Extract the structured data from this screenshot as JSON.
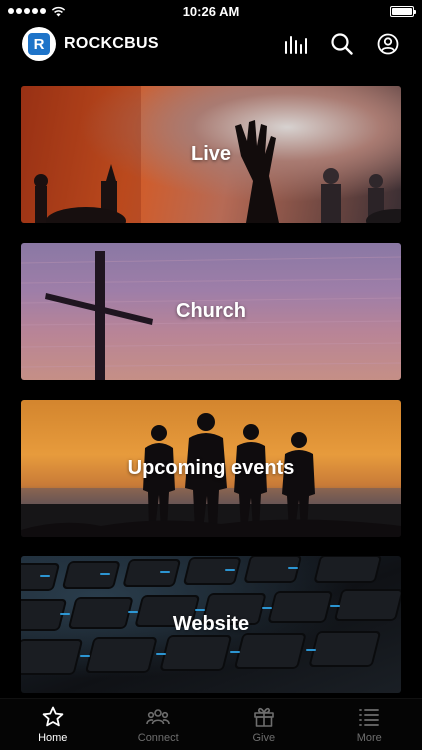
{
  "status": {
    "time": "10:26 AM"
  },
  "header": {
    "logo_letter": "R",
    "brand": "ROCKCBUS"
  },
  "cards": [
    {
      "label": "Live"
    },
    {
      "label": "Church"
    },
    {
      "label": "Upcoming events"
    },
    {
      "label": "Website"
    }
  ],
  "tabs": [
    {
      "label": "Home",
      "icon": "star-icon",
      "active": true
    },
    {
      "label": "Connect",
      "icon": "people-icon",
      "active": false
    },
    {
      "label": "Give",
      "icon": "gift-icon",
      "active": false
    },
    {
      "label": "More",
      "icon": "list-icon",
      "active": false
    }
  ],
  "colors": {
    "background": "#000000",
    "accent": "#1e74c9",
    "inactive": "#6e6e6e"
  }
}
